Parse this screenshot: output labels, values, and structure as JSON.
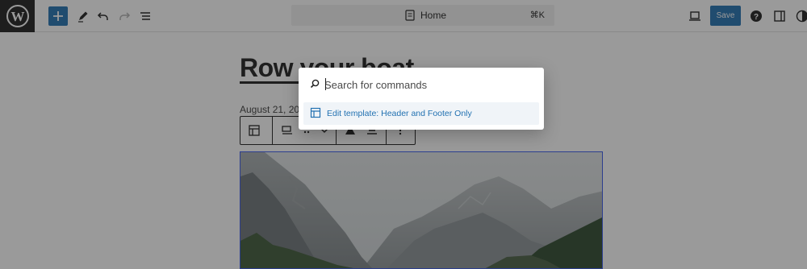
{
  "toolbar": {
    "document_title": "Home",
    "shortcut": "⌘K",
    "save_label": "Save",
    "accent_color": "#2271b1"
  },
  "post": {
    "title": "Row your boat",
    "date": "August 21, 2023"
  },
  "command_palette": {
    "placeholder": "Search for commands",
    "value": "",
    "results": [
      {
        "label": "Edit template: Header and Footer Only",
        "icon": "layout-icon"
      }
    ]
  },
  "icons": [
    "wordpress-logo",
    "plus-icon",
    "pencil-icon",
    "undo-icon",
    "redo-icon",
    "list-view-icon",
    "document-icon",
    "desktop-preview-icon",
    "help-icon",
    "settings-sidebar-icon",
    "styles-icon",
    "search-icon",
    "layout-icon",
    "image-icon"
  ]
}
